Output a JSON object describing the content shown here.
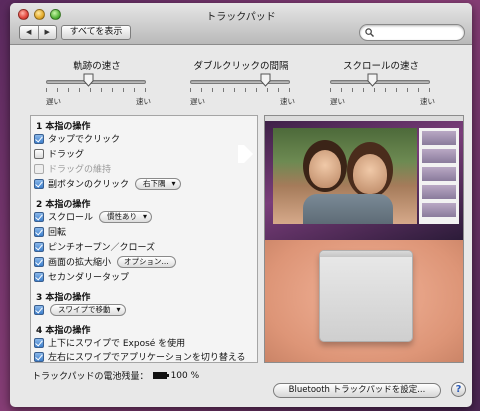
{
  "window": {
    "title": "トラックパッド"
  },
  "toolbar": {
    "back": "◀",
    "forward": "▶",
    "show_all": "すべてを表示"
  },
  "search": {
    "placeholder": "",
    "value": ""
  },
  "sliders": [
    {
      "label": "軌跡の速さ",
      "min_label": "遅い",
      "max_label": "速い",
      "value": 0.42
    },
    {
      "label": "ダブルクリックの間隔",
      "min_label": "遅い",
      "max_label": "速い",
      "value": 0.75
    },
    {
      "label": "スクロールの速さ",
      "min_label": "遅い",
      "max_label": "速い",
      "value": 0.42
    }
  ],
  "options": {
    "one_finger": {
      "title": "1 本指の操作",
      "tap_to_click": {
        "label": "タップでクリック",
        "checked": true
      },
      "dragging": {
        "label": "ドラッグ",
        "checked": false
      },
      "drag_lock": {
        "label": "ドラッグの維持",
        "checked": false,
        "enabled": false
      },
      "secondary_click": {
        "label": "副ボタンのクリック",
        "checked": true,
        "popup": "右下隅"
      }
    },
    "two_finger": {
      "title": "2 本指の操作",
      "scroll": {
        "label": "スクロール",
        "checked": true,
        "popup": "慣性あり"
      },
      "rotate": {
        "label": "回転",
        "checked": true
      },
      "pinch": {
        "label": "ピンチオープン／クローズ",
        "checked": true
      },
      "zoom": {
        "label": "画面の拡大縮小",
        "checked": true,
        "button": "オプション..."
      },
      "secondary_tap": {
        "label": "セカンダリータップ",
        "checked": true
      }
    },
    "three_finger": {
      "title": "3 本指の操作",
      "swipe": {
        "checked": true,
        "popup": "スワイプで移動"
      }
    },
    "four_finger": {
      "title": "4 本指の操作",
      "expose": {
        "label": "上下にスワイプで Exposé を使用",
        "checked": true
      },
      "app_switch": {
        "label": "左右にスワイプでアプリケーションを切り替える",
        "checked": true
      }
    }
  },
  "footer": {
    "battery_label": "トラックパッドの電池残量：",
    "battery_value": "100 %",
    "setup_button": "Bluetooth トラックパッドを設定...",
    "help": "?"
  }
}
